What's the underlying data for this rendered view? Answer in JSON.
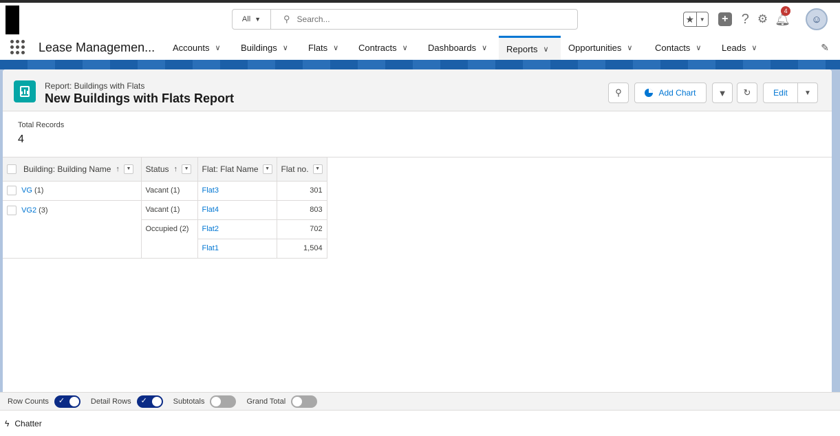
{
  "header": {
    "search_scope": "All",
    "search_placeholder": "Search...",
    "notification_count": "4"
  },
  "nav": {
    "app_name": "Lease Managemen...",
    "items": [
      {
        "label": "Accounts"
      },
      {
        "label": "Buildings"
      },
      {
        "label": "Flats"
      },
      {
        "label": "Contracts"
      },
      {
        "label": "Dashboards"
      },
      {
        "label": "Reports"
      },
      {
        "label": "Opportunities"
      },
      {
        "label": "Contacts"
      },
      {
        "label": "Leads"
      }
    ],
    "active": "Reports"
  },
  "report": {
    "kicker": "Report: Buildings with Flats",
    "title": "New Buildings with Flats Report",
    "add_chart_label": "Add Chart",
    "edit_label": "Edit",
    "total_records_label": "Total Records",
    "total_records_value": "4"
  },
  "table": {
    "headers": [
      "Building: Building Name",
      "Status",
      "Flat: Flat Name",
      "Flat no."
    ],
    "groups": [
      {
        "name": "VG",
        "count": "(1)"
      },
      {
        "name": "VG2",
        "count": "(3)"
      }
    ],
    "status_groups": [
      "Vacant (1)",
      "Vacant (1)",
      "Occupied (2)"
    ],
    "rows": [
      {
        "flat": "Flat3",
        "number": "301"
      },
      {
        "flat": "Flat4",
        "number": "803"
      },
      {
        "flat": "Flat2",
        "number": "702"
      },
      {
        "flat": "Flat1",
        "number": "1,504"
      }
    ]
  },
  "footer": {
    "toggles": [
      {
        "label": "Row Counts",
        "on": true
      },
      {
        "label": "Detail Rows",
        "on": true
      },
      {
        "label": "Subtotals",
        "on": false
      },
      {
        "label": "Grand Total",
        "on": false
      }
    ]
  },
  "utility": {
    "chatter_label": "Chatter"
  },
  "colors": {
    "brand_blue": "#0176d3",
    "toggle_on": "#0b2b86",
    "report_icon": "#05a6a6",
    "badge_red": "#c23934"
  }
}
